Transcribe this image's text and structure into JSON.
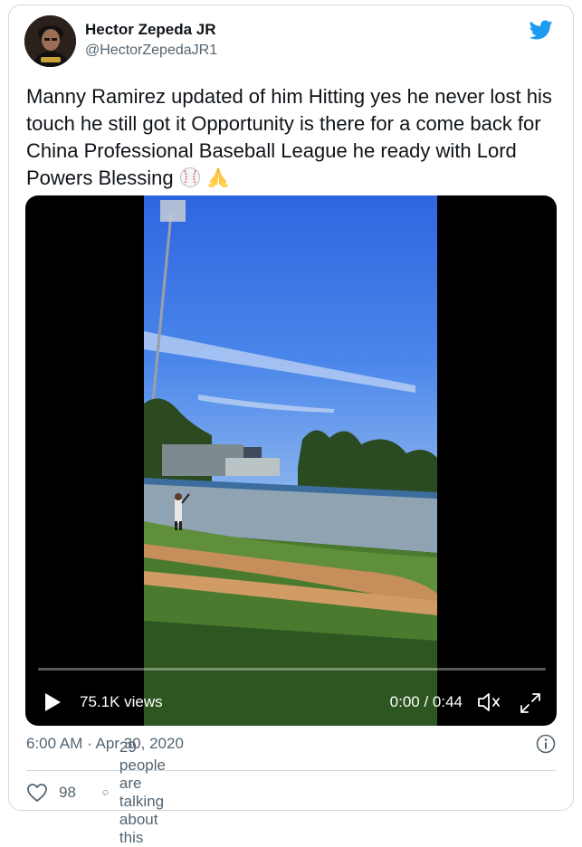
{
  "author": {
    "name": "Hector Zepeda JR",
    "handle": "@HectorZepedaJR1"
  },
  "tweet": {
    "text": "Manny Ramirez updated of him Hitting yes he never lost his touch he still got it Opportunity is there for a come back for China Professional Baseball League he ready with Lord Powers Blessing",
    "emojis": [
      "baseball-emoji",
      "folded-hands-emoji"
    ]
  },
  "video": {
    "views": "75.1K views",
    "time": "0:00 / 0:44",
    "progress": 0
  },
  "meta": {
    "timestamp": "6:00 AM · Apr 30, 2020"
  },
  "actions": {
    "likes": "98",
    "conversation": "29 people are talking about this"
  },
  "colors": {
    "brand": "#1d9bf0",
    "text": "#0f1419",
    "secondary": "#536471",
    "border": "#cfd9de"
  },
  "icons": [
    "twitter-bird-icon",
    "play-icon",
    "volume-icon",
    "fullscreen-icon",
    "info-icon",
    "heart-icon",
    "reply-bubble-icon"
  ]
}
